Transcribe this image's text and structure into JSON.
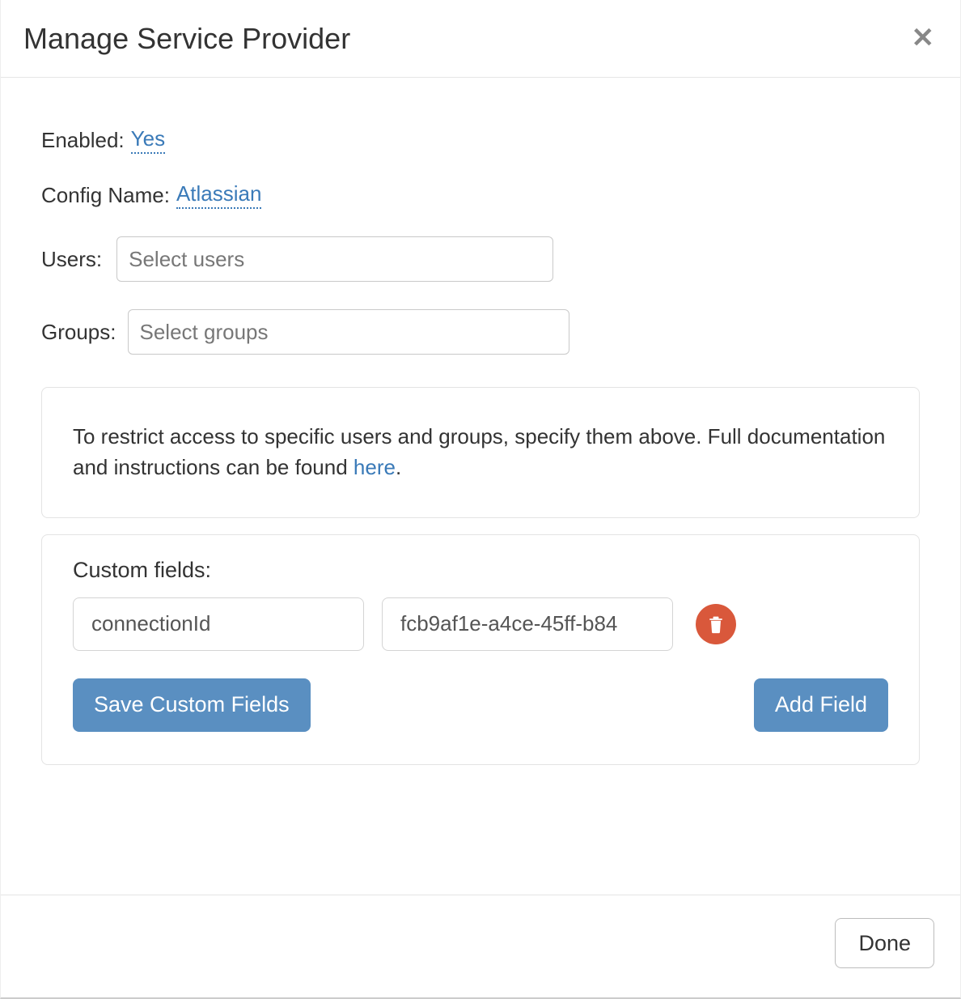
{
  "modal": {
    "title": "Manage Service Provider"
  },
  "form": {
    "enabled_label": "Enabled:",
    "enabled_value": "Yes",
    "config_name_label": "Config Name:",
    "config_name_value": "Atlassian",
    "users_label": "Users:",
    "users_placeholder": "Select users",
    "groups_label": "Groups:",
    "groups_placeholder": "Select groups"
  },
  "info": {
    "text_before": "To restrict access to specific users and groups, specify them above. Full documentation and instructions can be found ",
    "link_text": "here",
    "text_after": "."
  },
  "custom": {
    "heading": "Custom fields:",
    "fields": [
      {
        "key": "connectionId",
        "value": "fcb9af1e-a4ce-45ff-b84"
      }
    ],
    "save_label": "Save Custom Fields",
    "add_label": "Add Field"
  },
  "footer": {
    "done_label": "Done"
  }
}
